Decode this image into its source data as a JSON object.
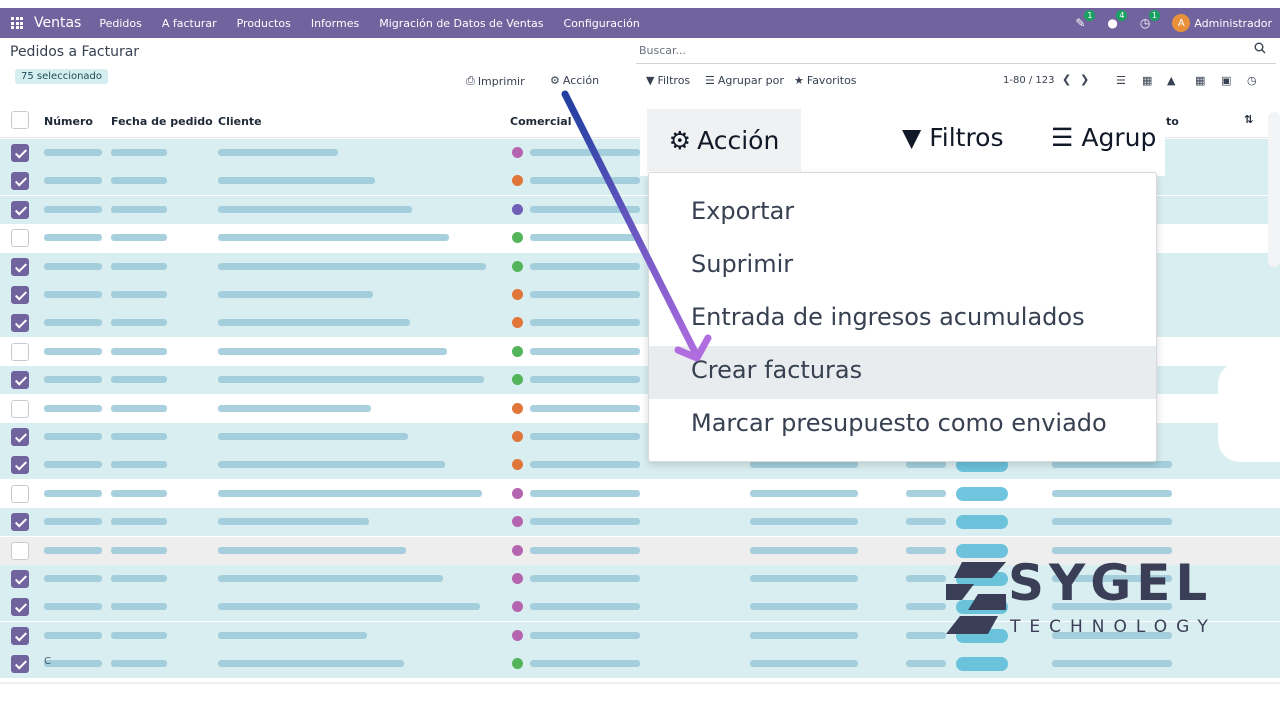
{
  "navbar": {
    "app_name": "Ventas",
    "menu": [
      "Pedidos",
      "A facturar",
      "Productos",
      "Informes",
      "Migración de Datos de Ventas",
      "Configuración"
    ],
    "activity_badge": "1",
    "messages_badge": "4",
    "clock_badge": "1",
    "avatar_letter": "A",
    "user": "Administrador"
  },
  "control_panel": {
    "title": "Pedidos a Facturar",
    "selected": "75 seleccionado",
    "print": "Imprimir",
    "action": "Acción",
    "search_placeholder": "Buscar...",
    "filters": "Filtros",
    "group_by": "Agrupar por",
    "favorites": "Favoritos",
    "pager": "1-80 / 123"
  },
  "table": {
    "columns": [
      "Número",
      "Fecha de pedido",
      "Cliente",
      "Comercial",
      "to"
    ],
    "rows_checked": [
      true,
      true,
      true,
      false,
      true,
      true,
      true,
      false,
      true,
      false,
      true,
      true,
      false,
      true,
      false,
      true,
      true,
      true,
      true
    ],
    "last_row_fragment": "C"
  },
  "zoom": {
    "action": "Acción",
    "filters": "Filtros",
    "group_partial": "Agrup",
    "dropdown_items": [
      "Exportar",
      "Suprimir",
      "Entrada de ingresos acumulados",
      "Crear facturas",
      "Marcar presupuesto como enviado"
    ],
    "active_item": "Crear facturas"
  },
  "logo": {
    "name": "SYGEL",
    "tagline": "TECHNOLOGY"
  },
  "colors": {
    "brand": "#71639e",
    "selected_row": "#d9eef1",
    "arrow_start": "#1f3fa0",
    "arrow_end": "#b06de0"
  }
}
